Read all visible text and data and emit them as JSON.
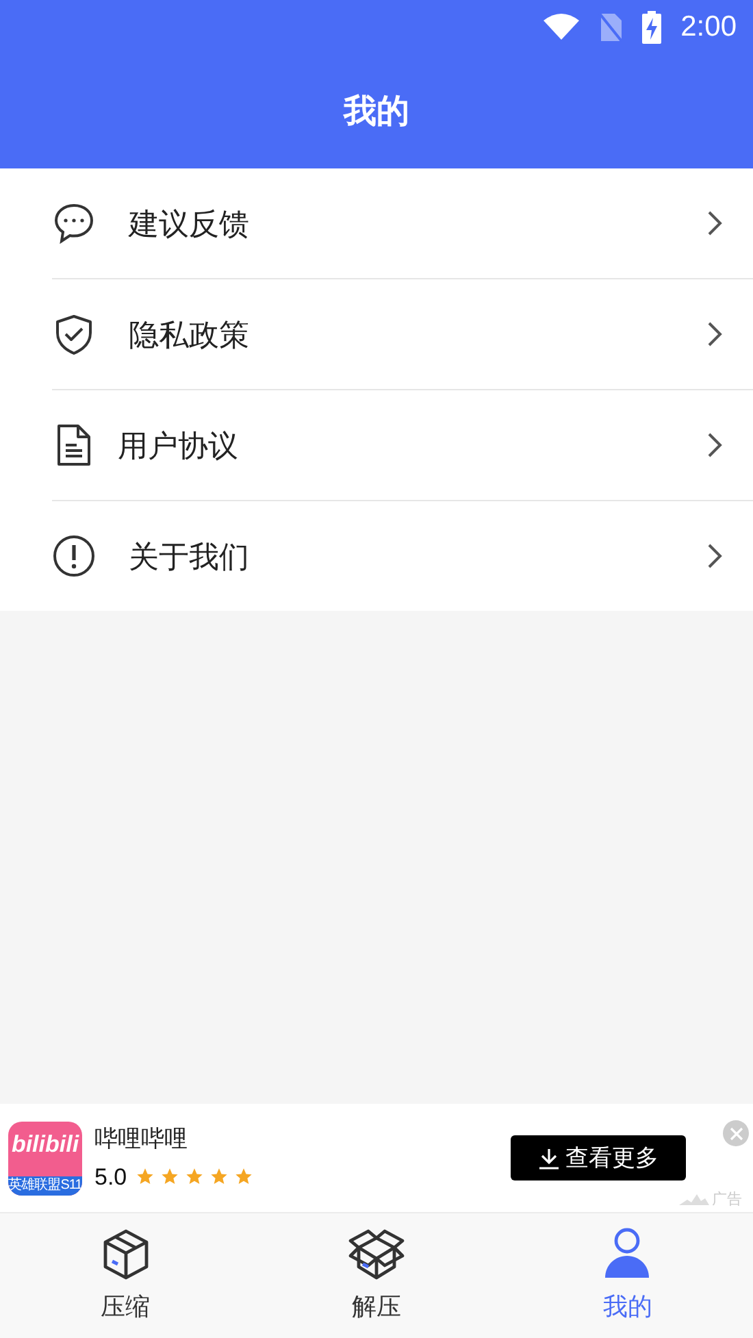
{
  "status_bar": {
    "time": "2:00"
  },
  "header": {
    "title": "我的"
  },
  "menu": [
    {
      "kind": "feedback",
      "label": "建议反馈"
    },
    {
      "kind": "privacy",
      "label": "隐私政策"
    },
    {
      "kind": "agreement",
      "label": "用户协议"
    },
    {
      "kind": "about",
      "label": "关于我们"
    }
  ],
  "ad": {
    "logo_text": "bilibili",
    "logo_banner": "英雄联盟S11",
    "app_name": "哔哩哔哩",
    "rating": "5.0",
    "stars": 5,
    "button": "查看更多",
    "ad_label": "广告"
  },
  "tabs": [
    {
      "kind": "compress",
      "label": "压缩",
      "selected": false
    },
    {
      "kind": "extract",
      "label": "解压",
      "selected": false
    },
    {
      "kind": "profile",
      "label": "我的",
      "selected": true
    }
  ]
}
